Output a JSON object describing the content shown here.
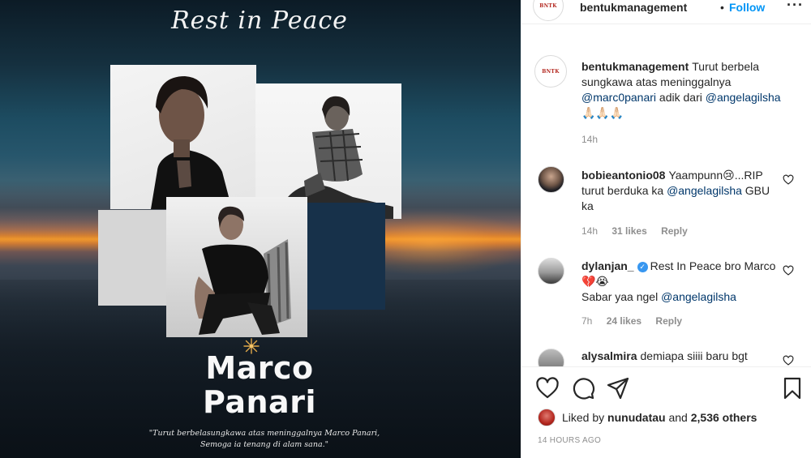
{
  "post_image": {
    "script_title": "Rest in Peace",
    "name_line_1": "Marco",
    "name_line_2": "Panari",
    "quote": "\"Turut berbelasungkawa atas meninggalnya Marco Panari, Semoga ia tenang di alam sana.\""
  },
  "header": {
    "avatar_logo": "BNTK",
    "username": "bentukmanagement",
    "separator": "•",
    "follow_label": "Follow",
    "more_icon": "more-options-icon"
  },
  "caption": {
    "avatar_logo": "BNTK",
    "username": "bentukmanagement",
    "text_1": "Turut berbela sungkawa atas meninggalnya ",
    "mention_1": "@marc0panari",
    "text_2": " adik dari ",
    "mention_2": "@angelagilsha",
    "emoji": "🙏🏻🙏🏻🙏🏻",
    "time": "14h"
  },
  "comments": [
    {
      "username": "bobieantonio08",
      "text_1": "Yaampunn😢...RIP turut berduka ka ",
      "mention": "@angelagilsha",
      "text_2": " GBU ka",
      "time": "14h",
      "likes": "31 likes",
      "reply": "Reply"
    },
    {
      "username": "dylanjan_",
      "text_1": "Rest In Peace bro Marco 💔😭",
      "text_line2": "Sabar yaa ngel ",
      "mention": "@angelagilsha",
      "time": "7h",
      "likes": "24 likes",
      "reply": "Reply"
    },
    {
      "username": "alysalmira",
      "text_1": "demiapa siiii baru bgt"
    }
  ],
  "likes": {
    "prefix": "Liked by ",
    "user": "nunudatau",
    "middle": " and ",
    "count": "2,536 others"
  },
  "timestamp": "14 HOURS AGO",
  "icons": {
    "like": "heart-icon",
    "comment": "comment-icon",
    "share": "share-icon",
    "save": "bookmark-icon"
  },
  "colors": {
    "accent": "#0095f6",
    "mention": "#00376b",
    "muted": "#8e8e8e",
    "verified": "#3897f0"
  }
}
